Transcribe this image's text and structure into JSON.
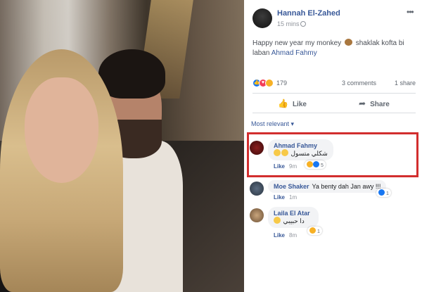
{
  "post": {
    "author": "Hannah El-Zahed",
    "time": "15 mins",
    "text_before": "Happy new year my monkey",
    "text_after": " shaklak kofta bi laban ",
    "mention": "Ahmad Fahmy",
    "reactions_count": "179",
    "comments_count": "3 comments",
    "shares_count": "1 share"
  },
  "actions": {
    "like": "Like",
    "share": "Share"
  },
  "sort_label": "Most relevant ▾",
  "comments": [
    {
      "name": "Ahmad Fahmy",
      "text": "شكلي متسول",
      "like": "Like",
      "time": "9m",
      "reactions": "5"
    },
    {
      "name": "Moe Shaker",
      "text": "Ya benty dah Jan awy !!!",
      "like": "Like",
      "time": "1m",
      "reactions": "1"
    },
    {
      "name": "Laila El Atar",
      "text": "دا حبيبي",
      "like": "Like",
      "time": "8m",
      "reactions": "1"
    }
  ],
  "icons": [
    "globe-icon",
    "more-icon",
    "like-reaction-icon",
    "love-reaction-icon",
    "haha-reaction-icon",
    "thumbs-up-icon",
    "share-arrow-icon",
    "monkey-emoji-icon"
  ],
  "colors": {
    "link": "#385898",
    "highlight": "#d22e2e",
    "like_blue": "#1877f2"
  }
}
